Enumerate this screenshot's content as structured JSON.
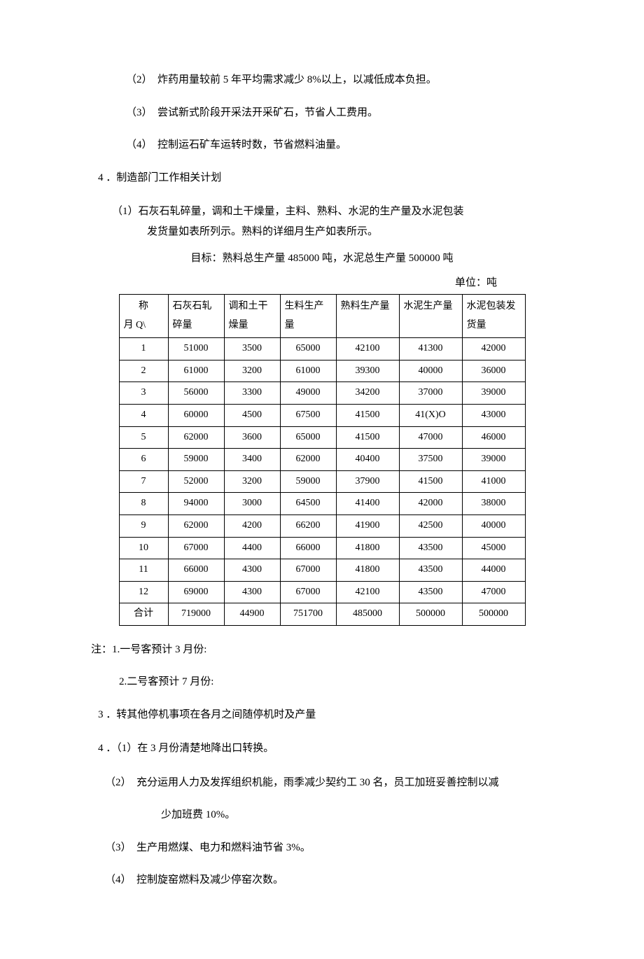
{
  "items_top": [
    {
      "num": "（2）",
      "text": "炸药用量较前 5 年平均需求减少 8%以上，以减低成本负担。"
    },
    {
      "num": "（3）",
      "text": "尝试新式阶段开采法开采矿石，节省人工费用。"
    },
    {
      "num": "（4）",
      "text": "控制运石矿车运转时数，节省燃料油量。"
    }
  ],
  "section4_title": "4 ．制造部门工作相关计划",
  "section4_sub1a": "（1）石灰石轧碎量，调和土干燥量，主料、熟料、水泥的生产量及水泥包装",
  "section4_sub1b": "发货量如表所列示。熟料的详细月生产如表所示。",
  "target_line": "目标：熟料总生产量 485000 吨，水泥总生产量 500000 吨",
  "unit_line": "单位：吨",
  "table": {
    "header_label": "称",
    "month_label": "月 Q\\",
    "cols": [
      "石灰石轧碎量",
      "调和土干燥量",
      "生料生产量",
      "熟料生产量",
      "水泥生产量",
      "水泥包装发货量"
    ],
    "rows": [
      [
        "1",
        "51000",
        "3500",
        "65000",
        "42100",
        "41300",
        "42000"
      ],
      [
        "2",
        "61000",
        "3200",
        "61000",
        "39300",
        "40000",
        "36000"
      ],
      [
        "3",
        "56000",
        "3300",
        "49000",
        "34200",
        "37000",
        "39000"
      ],
      [
        "4",
        "60000",
        "4500",
        "67500",
        "41500",
        "41(X)O",
        "43000"
      ],
      [
        "5",
        "62000",
        "3600",
        "65000",
        "41500",
        "47000",
        "46000"
      ],
      [
        "6",
        "59000",
        "3400",
        "62000",
        "40400",
        "37500",
        "39000"
      ],
      [
        "7",
        "52000",
        "3200",
        "59000",
        "37900",
        "41500",
        "41000"
      ],
      [
        "8",
        "94000",
        "3000",
        "64500",
        "41400",
        "42000",
        "38000"
      ],
      [
        "9",
        "62000",
        "4200",
        "66200",
        "41900",
        "42500",
        "40000"
      ],
      [
        "10",
        "67000",
        "4400",
        "66000",
        "41800",
        "43500",
        "45000"
      ],
      [
        "11",
        "66000",
        "4300",
        "67000",
        "41800",
        "43500",
        "44000"
      ],
      [
        "12",
        "69000",
        "4300",
        "67000",
        "42100",
        "43500",
        "47000"
      ],
      [
        "合计",
        "719000",
        "44900",
        "751700",
        "485000",
        "500000",
        "500000"
      ]
    ]
  },
  "note1": "注：1.一号客预计 3 月份:",
  "note2": "2.二号客预计 7 月份:",
  "item3": "3 ．转其他停机事项在各月之间随停机时及产量",
  "item4": "4 ．（1）在 3 月份清楚地降出口转换。",
  "items_bottom": [
    {
      "num": "（2）",
      "text": "充分运用人力及发挥组织机能，雨季减少契约工 30 名，员工加班妥善控制以减",
      "cont": "少加班费 10%。"
    },
    {
      "num": "（3）",
      "text": "生产用燃煤、电力和燃料油节省 3%。"
    },
    {
      "num": "（4）",
      "text": "控制旋窑燃料及减少停窑次数。"
    }
  ]
}
